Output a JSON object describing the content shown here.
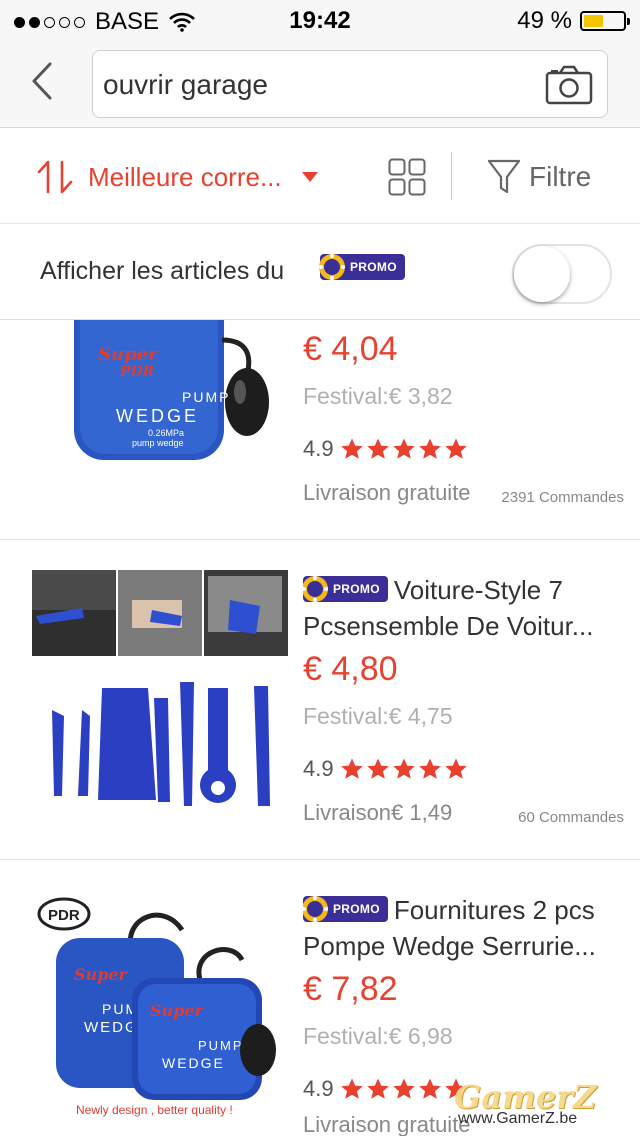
{
  "status_bar": {
    "carrier": "BASE",
    "time": "19:42",
    "battery": "49 %",
    "battery_level": 0.49
  },
  "search": {
    "query": "ouvrir garage"
  },
  "sort_bar": {
    "sort_label": "Meilleure corre...",
    "filter_label": "Filtre"
  },
  "promo_toggle": {
    "label": "Afficher les articles du",
    "badge": "PROMO",
    "enabled": false
  },
  "products": [
    {
      "title": "",
      "price": "€ 4,04",
      "festival": "Festival:€ 3,82",
      "rating": "4.9",
      "stars": 5,
      "shipping": "Livraison gratuite",
      "orders": "2391 Commandes",
      "image_text": {
        "brand": "Super PDR",
        "line1": "PUMP",
        "line2": "WEDGE",
        "line3": "0.26MPa",
        "line4": "pump wedge"
      }
    },
    {
      "badge": "PROMO",
      "title_line1": "Voiture-Style 7",
      "title_line2": "Pcsensemble De Voitur...",
      "price": "€ 4,80",
      "festival": "Festival:€ 4,75",
      "rating": "4.9",
      "stars": 5,
      "shipping": "Livraison€ 1,49",
      "orders": "60 Commandes"
    },
    {
      "badge": "PROMO",
      "title_line1": "Fournitures 2 pcs",
      "title_line2": "Pompe Wedge Serrurie...",
      "price": "€ 7,82",
      "festival": "Festival:€ 6,98",
      "rating": "4.9",
      "stars": 5,
      "shipping": "Livraison gratuite",
      "image_text": {
        "logo": "PDR",
        "line1": "PUMP",
        "line2": "WEDGE",
        "caption": "Newly design , better quality !"
      }
    }
  ],
  "watermark": {
    "main": "GamerZ",
    "sub": "www.GamerZ.be"
  },
  "colors": {
    "accent": "#e8412f",
    "promo": "#3b2f97",
    "star": "#e8412f",
    "wedge_blue": "#2a56c4"
  }
}
